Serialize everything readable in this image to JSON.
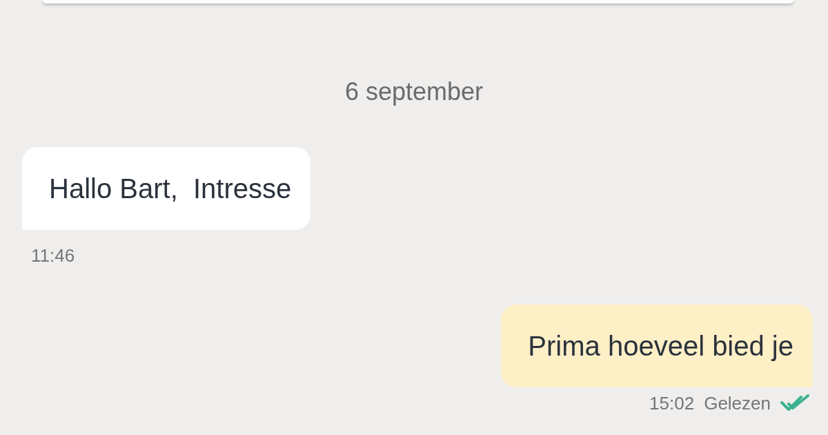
{
  "date_separator": "6 september",
  "messages": [
    {
      "kind": "incoming",
      "text": "Hallo Bart,  Intresse",
      "time": "11:46"
    },
    {
      "kind": "outgoing",
      "text": "Prima hoeveel bied je",
      "time": "15:02",
      "status": "Gelezen",
      "read": true
    }
  ]
}
